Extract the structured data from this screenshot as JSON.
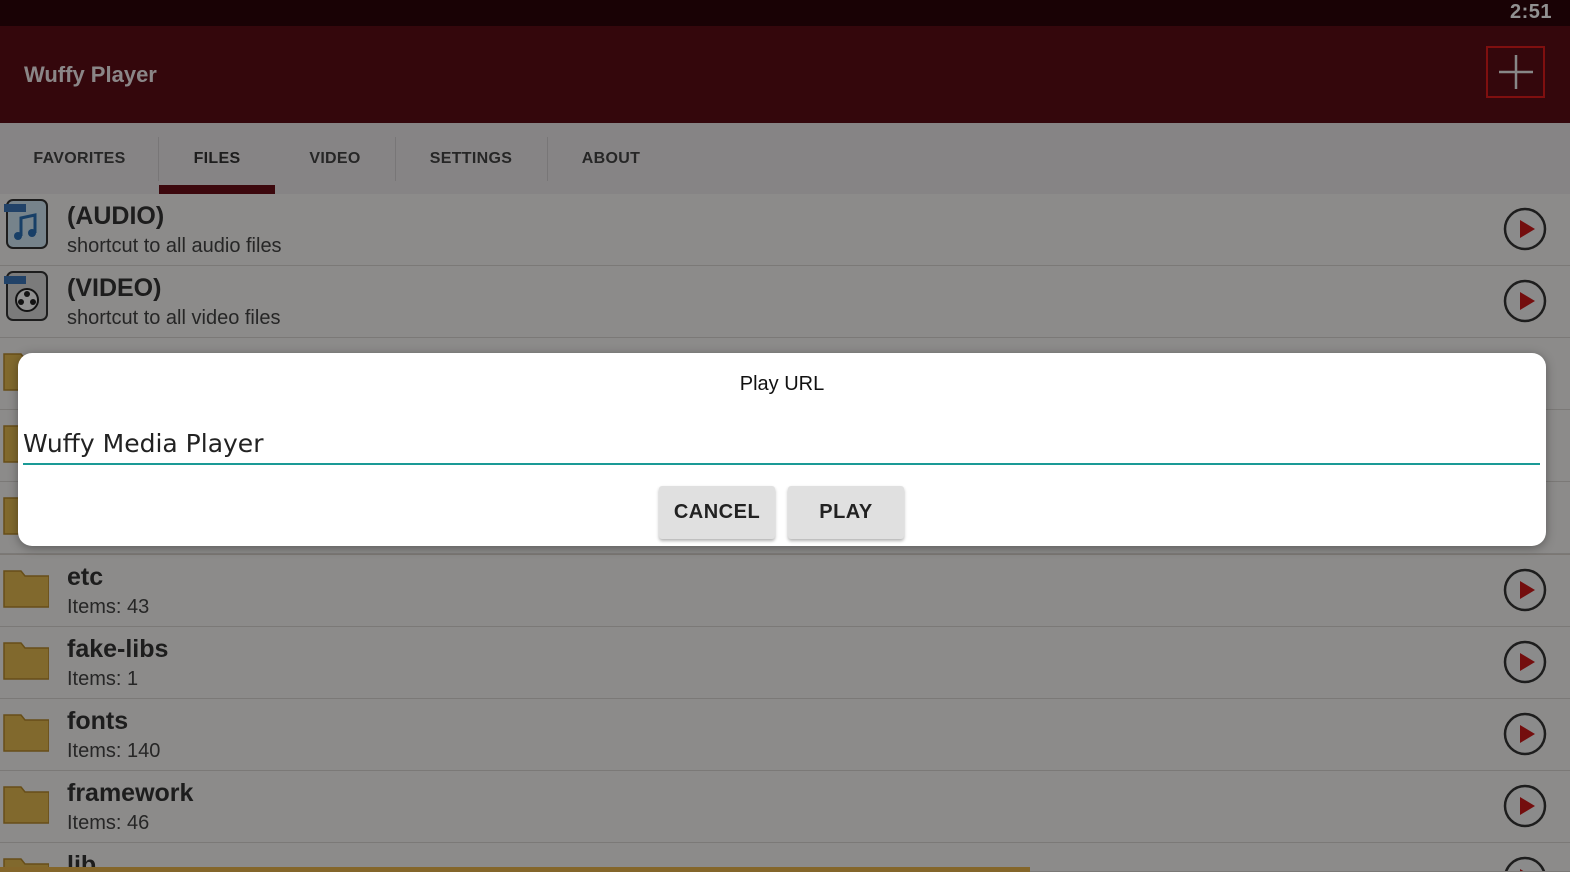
{
  "status_bar": {
    "time": "2:51"
  },
  "app_bar": {
    "title": "Wuffy Player",
    "add_icon": "plus-icon"
  },
  "tabs": [
    {
      "label": "FAVORITES",
      "active": false
    },
    {
      "label": "FILES",
      "active": true
    },
    {
      "label": "VIDEO",
      "active": false
    },
    {
      "label": "SETTINGS",
      "active": false
    },
    {
      "label": "ABOUT",
      "active": false
    }
  ],
  "list": [
    {
      "name": "(AUDIO)",
      "sub": "shortcut to all audio files",
      "icon": "audio-file-icon"
    },
    {
      "name": "(VIDEO)",
      "sub": "shortcut to all video files",
      "icon": "video-file-icon"
    },
    {
      "name": "",
      "sub": "",
      "icon": "folder-icon"
    },
    {
      "name": "",
      "sub": "",
      "icon": "folder-icon"
    },
    {
      "name": "",
      "sub": "",
      "icon": "folder-icon"
    },
    {
      "name": "etc",
      "sub": "Items: 43",
      "icon": "folder-icon"
    },
    {
      "name": "fake-libs",
      "sub": "Items: 1",
      "icon": "folder-icon"
    },
    {
      "name": "fonts",
      "sub": "Items: 140",
      "icon": "folder-icon"
    },
    {
      "name": "framework",
      "sub": "Items: 46",
      "icon": "folder-icon"
    },
    {
      "name": "lib",
      "sub": "",
      "icon": "folder-icon"
    }
  ],
  "dialog": {
    "title": "Play URL",
    "input_value": "Wuffy Media Player",
    "cancel_label": "CANCEL",
    "play_label": "PLAY"
  },
  "colors": {
    "status_bar": "#2c0509",
    "app_bar": "#5c0d16",
    "tab_indicator": "#6a0f18",
    "input_underline": "#1a9a96",
    "highlight_box": "#e01c1c"
  }
}
